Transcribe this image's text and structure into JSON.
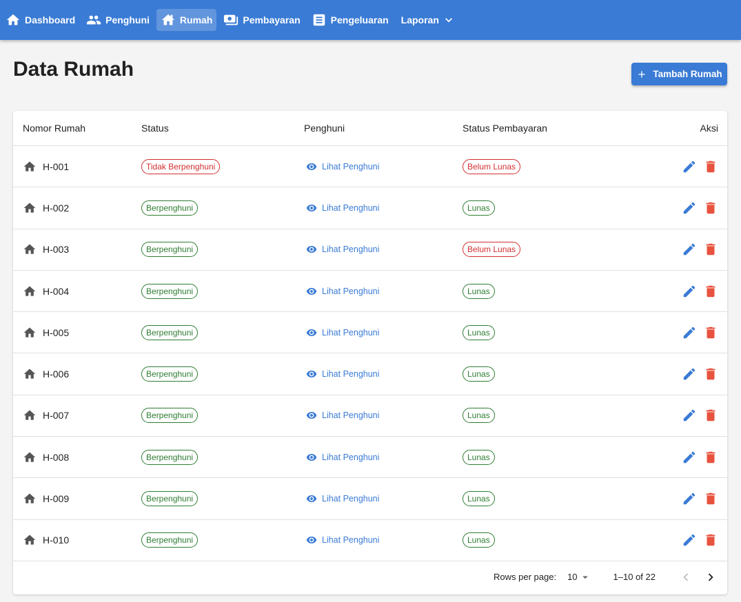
{
  "nav": {
    "items": [
      {
        "label": "Dashboard",
        "icon": "home-icon"
      },
      {
        "label": "Penghuni",
        "icon": "people-icon"
      },
      {
        "label": "Rumah",
        "icon": "house-icon"
      },
      {
        "label": "Pembayaran",
        "icon": "payment-icon"
      },
      {
        "label": "Pengeluaran",
        "icon": "receipt-icon"
      },
      {
        "label": "Laporan",
        "icon": "chevron-down-icon"
      }
    ],
    "active": "Rumah"
  },
  "page": {
    "title": "Data Rumah",
    "add_button": "Tambah Rumah"
  },
  "table": {
    "headers": {
      "nomor": "Nomor Rumah",
      "status": "Status",
      "penghuni": "Penghuni",
      "pembayaran": "Status Pembayaran",
      "aksi": "Aksi"
    },
    "rows": [
      {
        "nomor": "H-001",
        "status": "Tidak Berpenghuni",
        "penghuni": "Lihat Penghuni",
        "pembayaran": "Belum Lunas"
      },
      {
        "nomor": "H-002",
        "status": "Berpenghuni",
        "penghuni": "Lihat Penghuni",
        "pembayaran": "Lunas"
      },
      {
        "nomor": "H-003",
        "status": "Berpenghuni",
        "penghuni": "Lihat Penghuni",
        "pembayaran": "Belum Lunas"
      },
      {
        "nomor": "H-004",
        "status": "Berpenghuni",
        "penghuni": "Lihat Penghuni",
        "pembayaran": "Lunas"
      },
      {
        "nomor": "H-005",
        "status": "Berpenghuni",
        "penghuni": "Lihat Penghuni",
        "pembayaran": "Lunas"
      },
      {
        "nomor": "H-006",
        "status": "Berpenghuni",
        "penghuni": "Lihat Penghuni",
        "pembayaran": "Lunas"
      },
      {
        "nomor": "H-007",
        "status": "Berpenghuni",
        "penghuni": "Lihat Penghuni",
        "pembayaran": "Lunas"
      },
      {
        "nomor": "H-008",
        "status": "Berpenghuni",
        "penghuni": "Lihat Penghuni",
        "pembayaran": "Lunas"
      },
      {
        "nomor": "H-009",
        "status": "Berpenghuni",
        "penghuni": "Lihat Penghuni",
        "pembayaran": "Lunas"
      },
      {
        "nomor": "H-010",
        "status": "Berpenghuni",
        "penghuni": "Lihat Penghuni",
        "pembayaran": "Lunas"
      }
    ]
  },
  "pagination": {
    "rows_label": "Rows per page:",
    "rows_value": "10",
    "range": "1–10 of 22"
  },
  "colors": {
    "primary": "#3a7bd5",
    "success": "#2e7d32",
    "danger": "#d32f2f",
    "delete": "#e8533f"
  }
}
